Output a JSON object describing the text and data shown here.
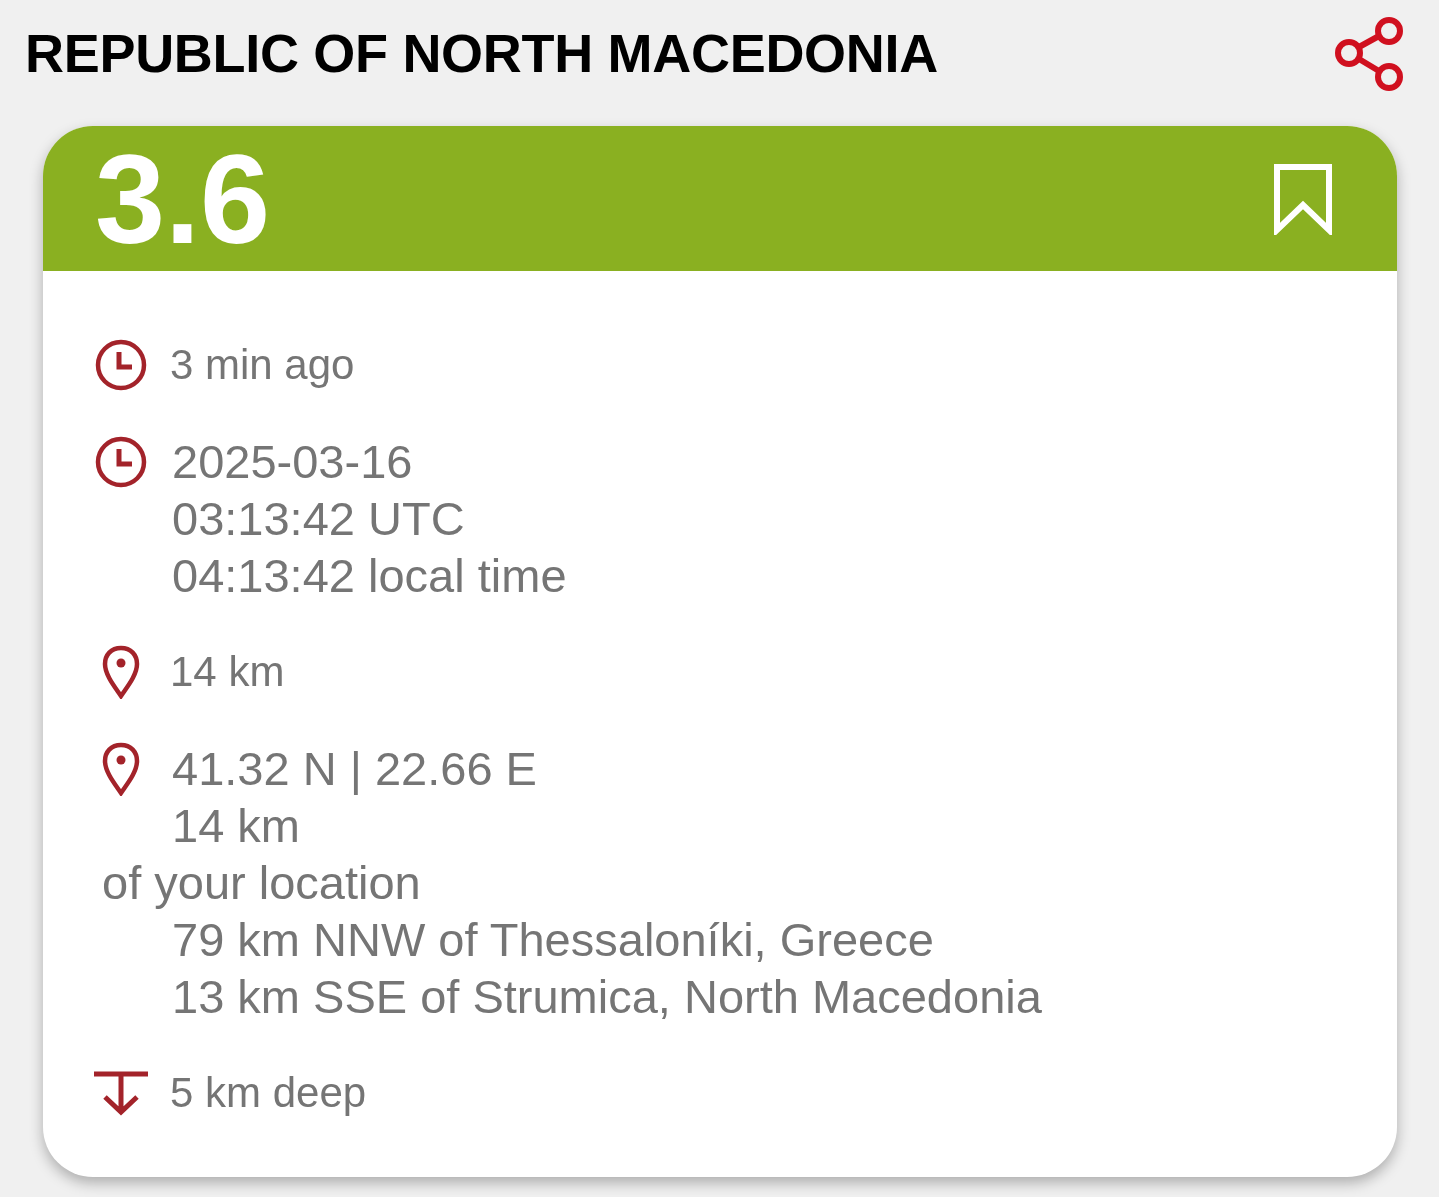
{
  "header": {
    "title": "REPUBLIC OF NORTH MACEDONIA"
  },
  "card": {
    "magnitude": "3.6"
  },
  "rows": [
    {
      "kind": "clock",
      "lines": [
        "3 min ago"
      ]
    },
    {
      "kind": "clock",
      "lines": [
        "2025-03-16",
        "03:13:42 UTC",
        "04:13:42 local time"
      ]
    },
    {
      "kind": "pin",
      "lines": [
        "14 km"
      ]
    },
    {
      "kind": "pin",
      "lines": [
        "41.32 N | 22.66 E",
        "14 km"
      ],
      "note": "of your location",
      "places": [
        "79 km NNW of Thessaloníki, Greece",
        "13 km SSE of Strumica, North Macedonia"
      ]
    },
    {
      "kind": "depth",
      "lines": [
        "5 km deep"
      ]
    }
  ]
}
